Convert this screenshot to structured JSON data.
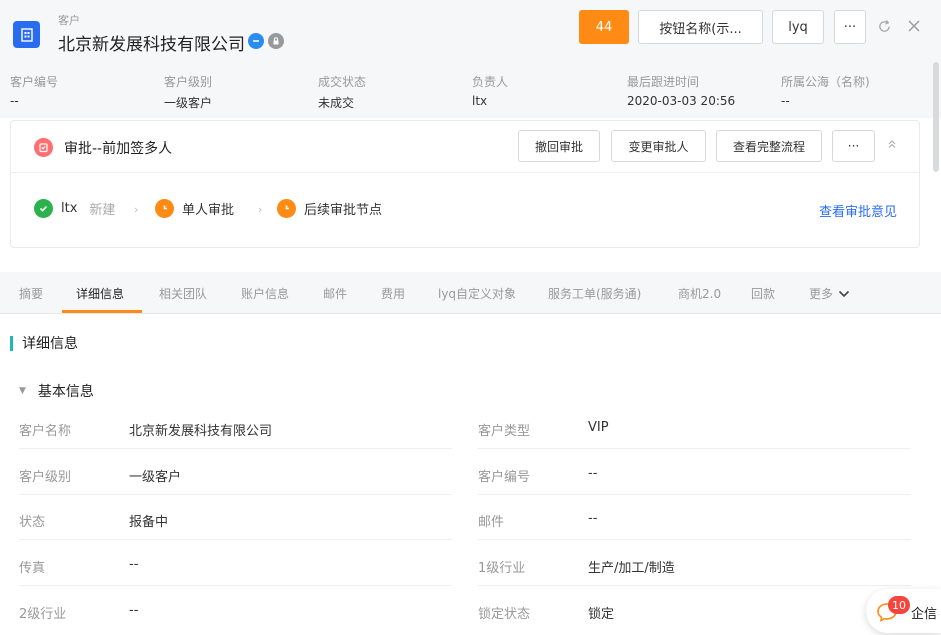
{
  "header": {
    "type_label": "客户",
    "title": "北京新发展科技有限公司",
    "orange_button": "44",
    "button_name": "按钮名称(示...",
    "user_button": "lyq",
    "more": "···",
    "icons": [
      "refresh-icon",
      "close-icon"
    ]
  },
  "info": [
    {
      "label": "客户编号",
      "value": "--"
    },
    {
      "label": "客户级别",
      "value": "一级客户"
    },
    {
      "label": "成交状态",
      "value": "未成交"
    },
    {
      "label": "负责人",
      "value": "ltx"
    },
    {
      "label": "最后跟进时间",
      "value": "2020-03-03 20:56"
    },
    {
      "label": "所属公海（名称)",
      "value": "--"
    }
  ],
  "approval": {
    "title": "审批--前加签多人",
    "buttons": [
      "撤回审批",
      "变更审批人",
      "查看完整流程"
    ],
    "more": "···",
    "flow": [
      {
        "name": "ltx",
        "status": "新建",
        "state": "done"
      },
      {
        "name": "单人审批",
        "status": "",
        "state": "pending"
      },
      {
        "name": "后续审批节点",
        "status": "",
        "state": "pending"
      }
    ],
    "view_opinion": "查看审批意见"
  },
  "tabs": [
    "摘要",
    "详细信息",
    "相关团队",
    "账户信息",
    "邮件",
    "费用",
    "lyq自定义对象",
    "服务工单(服务通)",
    "商机2.0",
    "回款",
    "更多"
  ],
  "active_tab": "详细信息",
  "detail": {
    "section_title": "详细信息",
    "sub_title": "基本信息",
    "left_fields": [
      {
        "label": "客户名称",
        "value": "北京新发展科技有限公司"
      },
      {
        "label": "客户级别",
        "value": "一级客户"
      },
      {
        "label": "状态",
        "value": "报备中"
      },
      {
        "label": "传真",
        "value": "--"
      },
      {
        "label": "2级行业",
        "value": "--"
      }
    ],
    "right_fields": [
      {
        "label": "客户类型",
        "value": "VIP"
      },
      {
        "label": "客户编号",
        "value": "--"
      },
      {
        "label": "邮件",
        "value": "--"
      },
      {
        "label": "1级行业",
        "value": "生产/加工/制造"
      },
      {
        "label": "锁定状态",
        "value": "锁定"
      }
    ]
  },
  "chat": {
    "badge": "10",
    "label": "企信"
  },
  "colors": {
    "accent": "#ff8a14",
    "link": "#2a6cf0",
    "brand": "#2a6cf0",
    "success": "#2bb24c",
    "section": "#21b6b6"
  }
}
